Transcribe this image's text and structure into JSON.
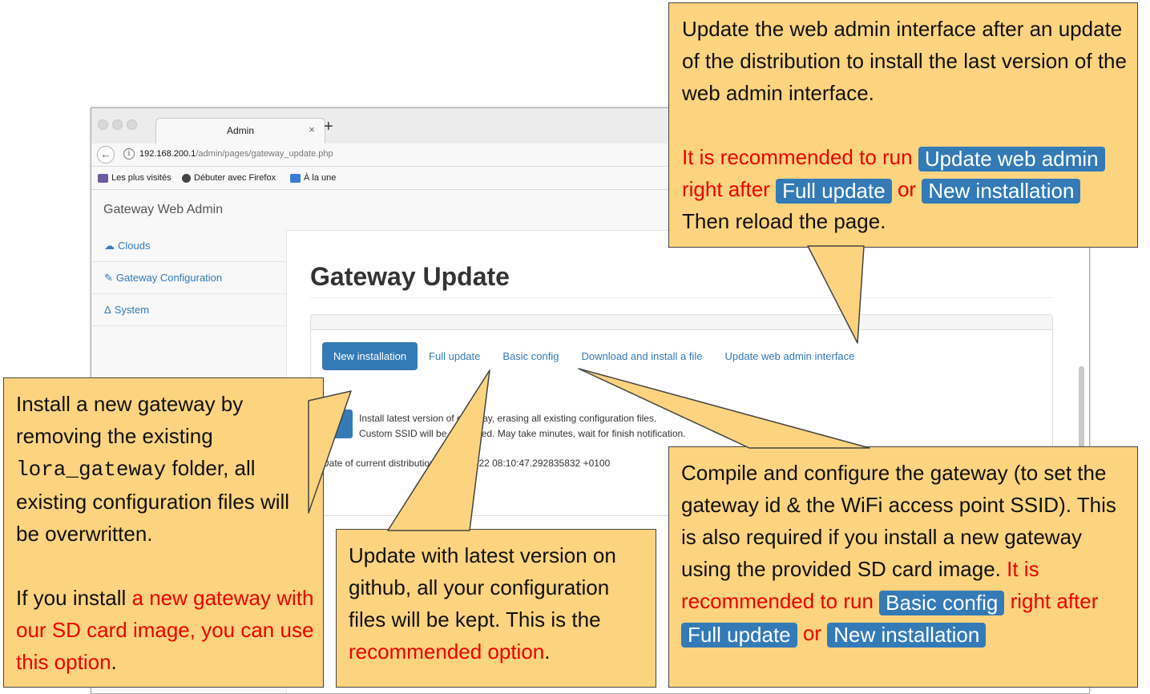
{
  "browser": {
    "tab_title": "Admin",
    "tab_close": "×",
    "new_tab": "+",
    "url_host": "192.168.200.1",
    "url_path": "/admin/pages/gateway_update.php",
    "bookmarks": [
      "Les plus visités",
      "Débuter avec Firefox",
      "À la une"
    ]
  },
  "app": {
    "brand": "Gateway Web Admin",
    "sidebar": [
      {
        "label": "Clouds",
        "icon": "cloud-icon"
      },
      {
        "label": "Gateway Configuration",
        "icon": "edit-icon"
      },
      {
        "label": "System",
        "icon": "linux-icon"
      }
    ],
    "page_title": "Gateway Update",
    "tabs": [
      "New installation",
      "Full update",
      "Basic config",
      "Download and install a file",
      "Update web admin interface"
    ],
    "description_line1": "Install latest version of gateway, erasing all existing configuration files.",
    "description_line2": "Custom SSID will be preserved. May take minutes, wait for finish notification.",
    "distribution_text": "Date of current distribution: 2017-12-22 08:10:47.292835832 +0100"
  },
  "callouts": {
    "top_right": {
      "line1": "Update the web admin interface after an update of the distribution to install the last version of the web admin interface.",
      "rec_prefix": "It is recommended to run",
      "pill_update_web_admin": "Update web admin",
      "right_after": "right after",
      "pill_full_update": "Full update",
      "or": "or",
      "pill_new_installation": "New installation",
      "reload": "Then reload the page."
    },
    "left": {
      "text1": "Install a new gateway by removing the existing",
      "folder": "lora_gateway",
      "text2": "folder, all existing configuration files will be overwritten.",
      "text3": "If you install",
      "red_text": "a new gateway with our SD card image, you can use this option",
      "period": "."
    },
    "middle": {
      "text1": "Update with latest version on github, all your configuration files will be kept. This is the",
      "red_text": "recommended option",
      "period": "."
    },
    "bottom_right": {
      "text1": "Compile and configure the gateway (to set the gateway id & the WiFi access point SSID). This is also required if you install a new gateway using the provided SD card image.",
      "red_text": "It is recommended to run",
      "pill_basic_config": "Basic config",
      "right_after": "right after",
      "pill_full_update": "Full update",
      "or": "or",
      "pill_new_installation": "New installation"
    }
  },
  "colors": {
    "callout_bg": "#fcd47f",
    "accent_blue": "#337ab7",
    "emphasis_red": "#ee0000"
  }
}
